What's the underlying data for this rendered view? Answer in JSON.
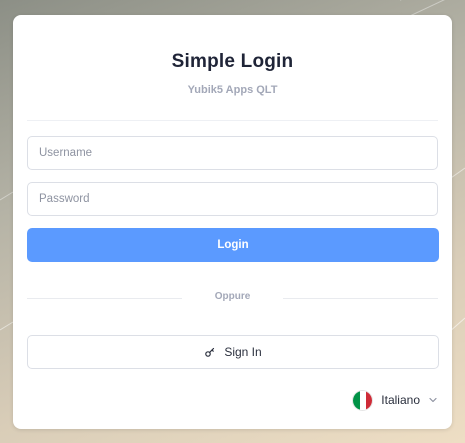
{
  "app": {
    "title": "Simple Login",
    "subtitle": "Yubik5 Apps QLT"
  },
  "form": {
    "username_placeholder": "Username",
    "username_value": "",
    "password_placeholder": "Password",
    "password_value": "",
    "login_label": "Login"
  },
  "separator": {
    "label": "Oppure"
  },
  "alt_login": {
    "label": "Sign In",
    "icon": "key-icon"
  },
  "language": {
    "selected": "Italiano",
    "flag": "italy-flag-icon",
    "flag_colors": [
      "#009246",
      "#ffffff",
      "#ce2b37"
    ]
  },
  "colors": {
    "primary": "#5b9aff",
    "title": "#1f2437",
    "muted": "#a3a8b8"
  }
}
